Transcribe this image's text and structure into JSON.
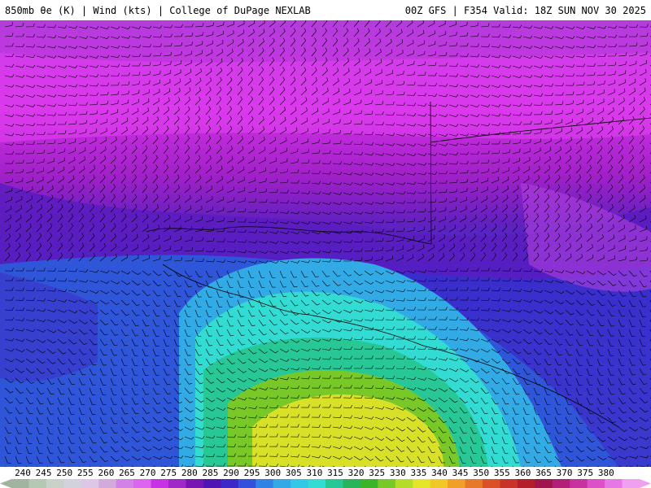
{
  "header": {
    "left_text": "850mb θe (K) | Wind (kts) | College of DuPage NEXLAB",
    "right_text": "00Z GFS | F354 Valid: 18Z SUN NOV 30 2025"
  },
  "legend": {
    "labels": [
      "240",
      "245",
      "250",
      "255",
      "260",
      "265",
      "270",
      "275",
      "280",
      "285",
      "290",
      "295",
      "300",
      "305",
      "310",
      "315",
      "320",
      "325",
      "330",
      "335",
      "340",
      "345",
      "350",
      "355",
      "360",
      "365",
      "370",
      "375",
      "380"
    ],
    "colors": [
      "#a0b4a0",
      "#b4c8b4",
      "#c8d2c8",
      "#d2d2dc",
      "#dcc8e6",
      "#d2aadc",
      "#d282e6",
      "#dc64f0",
      "#c832e6",
      "#a028c8",
      "#7814b4",
      "#5014b4",
      "#3c28c8",
      "#3250dc",
      "#3282e6",
      "#32aae6",
      "#32c8e6",
      "#32dcd2",
      "#28c896",
      "#28b45a",
      "#3cb428",
      "#78c828",
      "#b4dc28",
      "#e6e628",
      "#f0c828",
      "#f0a028",
      "#e67828",
      "#dc5028",
      "#c83228",
      "#b41e28",
      "#a01450",
      "#b41e78",
      "#c832a0",
      "#dc50c8",
      "#e678e6",
      "#f0a0f0"
    ]
  }
}
